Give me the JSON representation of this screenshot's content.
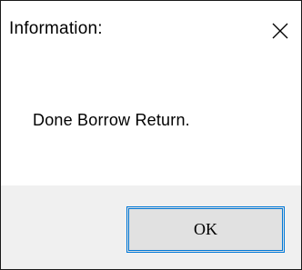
{
  "window": {
    "title": "Information:",
    "close_icon": "close-icon"
  },
  "content": {
    "message": "Done Borrow Return."
  },
  "footer": {
    "ok_label": "OK"
  },
  "colors": {
    "border": "#1a1a1a",
    "footer_bg": "#f0f0f0",
    "button_bg": "#e1e1e1",
    "focus_accent": "#0078d7"
  }
}
